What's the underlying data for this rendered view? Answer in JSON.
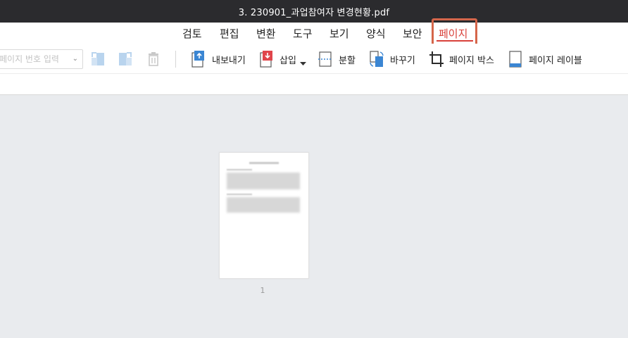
{
  "window": {
    "title": "3. 230901_과업참여자 변경현황.pdf"
  },
  "menu": {
    "items": [
      {
        "id": "review",
        "label": "검토"
      },
      {
        "id": "edit",
        "label": "편집"
      },
      {
        "id": "convert",
        "label": "변환"
      },
      {
        "id": "tools",
        "label": "도구"
      },
      {
        "id": "view",
        "label": "보기"
      },
      {
        "id": "form",
        "label": "양식"
      },
      {
        "id": "security",
        "label": "보안"
      },
      {
        "id": "page",
        "label": "페이지"
      }
    ],
    "active": "페이지"
  },
  "toolbar": {
    "page_input_placeholder": "페이지 번호 입력",
    "export_label": "내보내기",
    "insert_label": "삽입",
    "split_label": "분할",
    "replace_label": "바꾸기",
    "page_box_label": "페이지 박스",
    "page_label_label": "페이지 레이블"
  },
  "thumbnails": [
    {
      "page_number": "1"
    }
  ],
  "colors": {
    "titlebar_bg": "#2b2b2e",
    "accent": "#d9413a",
    "highlight_box": "#d5664a",
    "icon_blue": "#3b86d3",
    "icon_red": "#e0454b",
    "workspace_bg": "#e9ebee"
  }
}
